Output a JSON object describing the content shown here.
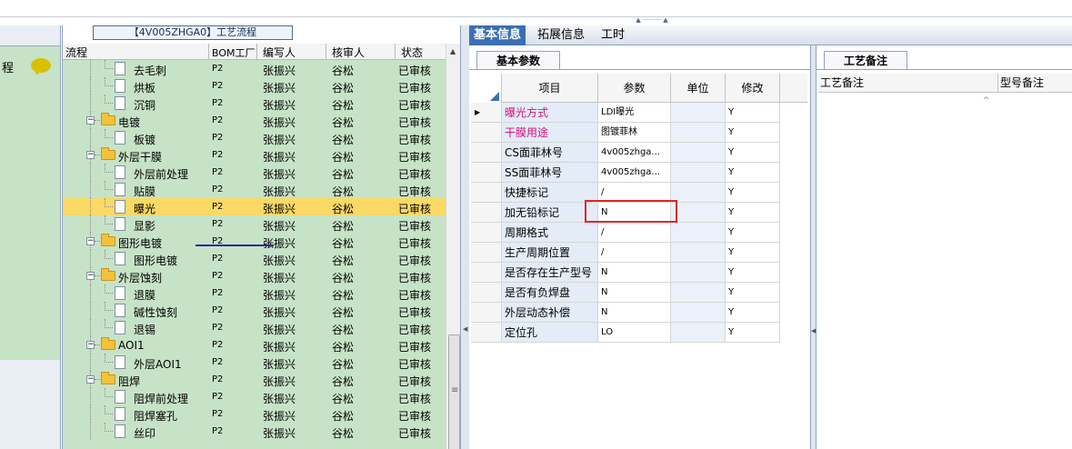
{
  "tree_panel": {
    "title": "【4V005ZHGA0】工艺流程",
    "columns": [
      "流程",
      "BOM工厂",
      "编写人",
      "核审人",
      "状态"
    ],
    "rows": [
      {
        "name": "去毛刺",
        "type": "doc",
        "level": 1,
        "bom": "P2",
        "writer": "张振兴",
        "reviewer": "谷松",
        "status": "已审核"
      },
      {
        "name": "烘板",
        "type": "doc",
        "level": 1,
        "bom": "P2",
        "writer": "张振兴",
        "reviewer": "谷松",
        "status": "已审核"
      },
      {
        "name": "沉铜",
        "type": "doc",
        "level": 1,
        "bom": "P2",
        "writer": "张振兴",
        "reviewer": "谷松",
        "status": "已审核"
      },
      {
        "name": "电镀",
        "type": "folder",
        "level": 0,
        "bom": "P2",
        "writer": "张振兴",
        "reviewer": "谷松",
        "status": "已审核"
      },
      {
        "name": "板镀",
        "type": "doc",
        "level": 1,
        "bom": "P2",
        "writer": "张振兴",
        "reviewer": "谷松",
        "status": "已审核"
      },
      {
        "name": "外层干膜",
        "type": "folder",
        "level": 0,
        "bom": "P2",
        "writer": "张振兴",
        "reviewer": "谷松",
        "status": "已审核"
      },
      {
        "name": "外层前处理",
        "type": "doc",
        "level": 1,
        "bom": "P2",
        "writer": "张振兴",
        "reviewer": "谷松",
        "status": "已审核"
      },
      {
        "name": "贴膜",
        "type": "doc",
        "level": 1,
        "bom": "P2",
        "writer": "张振兴",
        "reviewer": "谷松",
        "status": "已审核"
      },
      {
        "name": "曝光",
        "type": "doc",
        "level": 1,
        "bom": "P2",
        "writer": "张振兴",
        "reviewer": "谷松",
        "status": "已审核",
        "selected": true
      },
      {
        "name": "显影",
        "type": "doc",
        "level": 1,
        "bom": "P2",
        "writer": "张振兴",
        "reviewer": "谷松",
        "status": "已审核"
      },
      {
        "name": "图形电镀",
        "type": "folder",
        "level": 0,
        "bom": "P2",
        "writer": "张振兴",
        "reviewer": "谷松",
        "status": "已审核"
      },
      {
        "name": "图形电镀",
        "type": "doc",
        "level": 1,
        "bom": "P2",
        "writer": "张振兴",
        "reviewer": "谷松",
        "status": "已审核"
      },
      {
        "name": "外层蚀刻",
        "type": "folder",
        "level": 0,
        "bom": "P2",
        "writer": "张振兴",
        "reviewer": "谷松",
        "status": "已审核"
      },
      {
        "name": "退膜",
        "type": "doc",
        "level": 1,
        "bom": "P2",
        "writer": "张振兴",
        "reviewer": "谷松",
        "status": "已审核"
      },
      {
        "name": "碱性蚀刻",
        "type": "doc",
        "level": 1,
        "bom": "P2",
        "writer": "张振兴",
        "reviewer": "谷松",
        "status": "已审核"
      },
      {
        "name": "退锡",
        "type": "doc",
        "level": 1,
        "bom": "P2",
        "writer": "张振兴",
        "reviewer": "谷松",
        "status": "已审核"
      },
      {
        "name": "AOI1",
        "type": "folder",
        "level": 0,
        "bom": "P2",
        "writer": "张振兴",
        "reviewer": "谷松",
        "status": "已审核"
      },
      {
        "name": "外层AOI1",
        "type": "doc",
        "level": 1,
        "bom": "P2",
        "writer": "张振兴",
        "reviewer": "谷松",
        "status": "已审核"
      },
      {
        "name": "阻焊",
        "type": "folder",
        "level": 0,
        "bom": "P2",
        "writer": "张振兴",
        "reviewer": "谷松",
        "status": "已审核"
      },
      {
        "name": "阻焊前处理",
        "type": "doc",
        "level": 1,
        "bom": "P2",
        "writer": "张振兴",
        "reviewer": "谷松",
        "status": "已审核"
      },
      {
        "name": "阻焊塞孔",
        "type": "doc",
        "level": 1,
        "bom": "P2",
        "writer": "张振兴",
        "reviewer": "谷松",
        "status": "已审核"
      },
      {
        "name": "丝印",
        "type": "doc",
        "level": 1,
        "bom": "P2",
        "writer": "张振兴",
        "reviewer": "谷松",
        "status": "已审核"
      }
    ]
  },
  "left_strip": {
    "label": "程"
  },
  "tabs": [
    "基本信息",
    "拓展信息",
    "工时"
  ],
  "active_tab": "基本信息",
  "basic_params": {
    "subtab": "基本参数",
    "columns": [
      "项目",
      "参数",
      "单位",
      "修改"
    ],
    "rows": [
      {
        "item": "曝光方式",
        "param": "LDI曝光",
        "unit": "",
        "mod": "Y",
        "red": true,
        "current": true
      },
      {
        "item": "干膜用途",
        "param": "图镀菲林",
        "unit": "",
        "mod": "Y",
        "red": true
      },
      {
        "item": "CS面菲林号",
        "param": "4v005zhga...",
        "unit": "",
        "mod": "Y"
      },
      {
        "item": "SS面菲林号",
        "param": "4v005zhga...",
        "unit": "",
        "mod": "Y"
      },
      {
        "item": "快捷标记",
        "param": "/",
        "unit": "",
        "mod": "Y"
      },
      {
        "item": "加无铅标记",
        "param": "N",
        "unit": "",
        "mod": "Y"
      },
      {
        "item": "周期格式",
        "param": "/",
        "unit": "",
        "mod": "Y"
      },
      {
        "item": "生产周期位置",
        "param": "/",
        "unit": "",
        "mod": "Y"
      },
      {
        "item": "是否存在生产型号",
        "param": "N",
        "unit": "",
        "mod": "Y"
      },
      {
        "item": "是否有负焊盘",
        "param": "N",
        "unit": "",
        "mod": "Y"
      },
      {
        "item": "外层动态补偿",
        "param": "N",
        "unit": "",
        "mod": "Y"
      },
      {
        "item": "定位孔",
        "param": "LO",
        "unit": "",
        "mod": "Y"
      }
    ]
  },
  "process_notes": {
    "subtab": "工艺备注",
    "columns": [
      "工艺备注",
      "型号备注"
    ]
  },
  "icons": {
    "tree_scroll_up": "▲",
    "row_pointer": "▶",
    "expanded": "−",
    "notes_scroll_up": "^"
  },
  "colors": {
    "tree_bg": "#c7e3c7",
    "selected_row": "#fbd965",
    "active_tab": "#3c6fb4",
    "red_text": "#d4147a",
    "highlight_box": "#e0262a"
  }
}
